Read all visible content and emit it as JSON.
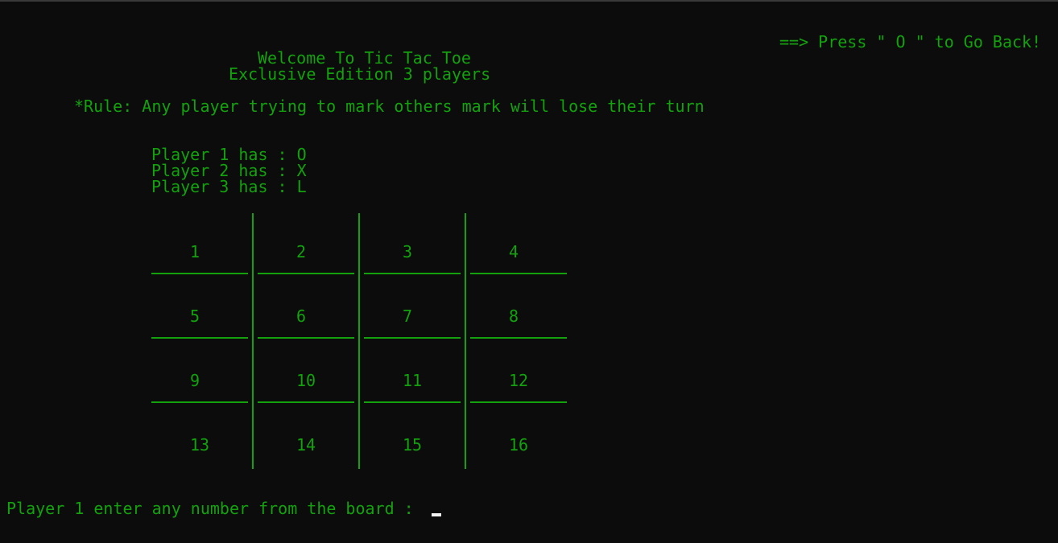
{
  "header": {
    "back_hint": "==> Press \" O \" to Go Back!",
    "welcome": "Welcome To Tic Tac Toe",
    "edition": "Exclusive Edition 3 players",
    "rule": "*Rule: Any player trying to mark others mark will lose their turn"
  },
  "players": [
    "Player 1 has : O",
    "Player 2 has : X",
    "Player 3 has : L"
  ],
  "board": {
    "cells": [
      "1",
      "2",
      "3",
      "4",
      "5",
      "6",
      "7",
      "8",
      "9",
      "10",
      "11",
      "12",
      "13",
      "14",
      "15",
      "16"
    ]
  },
  "prompt": "Player 1 enter any number from the board :",
  "colors": {
    "background": "#0c0c0c",
    "text": "#13a10e",
    "cursor": "#f2f2f2"
  }
}
